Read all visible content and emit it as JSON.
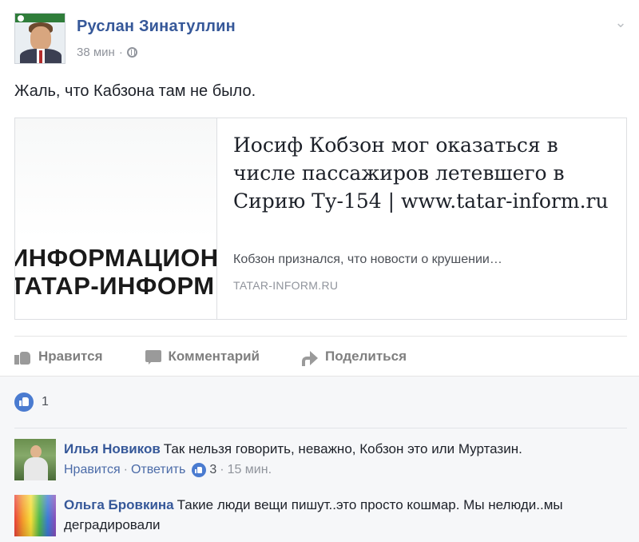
{
  "post": {
    "author": "Руслан Зинатуллин",
    "time": "38 мин",
    "separator": "·",
    "text": "Жаль, что Кабзона там не было.",
    "link_card": {
      "image_text_line1": "ИНФОРМАЦИОН",
      "image_text_line2": "ТАТАР-ИНФОРМ",
      "title": "Иосиф Кобзон мог оказаться в числе пассажиров летевшего в Сирию Ту-154 | www.tatar-inform.ru",
      "description": "Кобзон признался, что новости о крушении…",
      "domain": "TATAR-INFORM.RU"
    },
    "actions": {
      "like": "Нравится",
      "comment": "Комментарий",
      "share": "Поделиться"
    }
  },
  "reactions": {
    "like_count": "1"
  },
  "comments": [
    {
      "author": "Илья Новиков",
      "text": "Так нельзя говорить, неважно, Кобзон это или Муртазин.",
      "like_label": "Нравится",
      "reply_label": "Ответить",
      "likes": "3",
      "time": "15 мин.",
      "dot": "·"
    },
    {
      "author": "Ольга Бровкина",
      "text": "Такие люди вещи пишут..это просто кошмар. Мы нелюди..мы деградировали"
    }
  ],
  "icons": {
    "globe": "globe-icon",
    "chevron": "chevron-down-icon",
    "like": "thumb-icon",
    "comment": "comment-icon",
    "share": "share-icon"
  },
  "colors": {
    "name_link": "#365899",
    "meta_gray": "#90949c",
    "like_blue": "#4a7bd0"
  }
}
